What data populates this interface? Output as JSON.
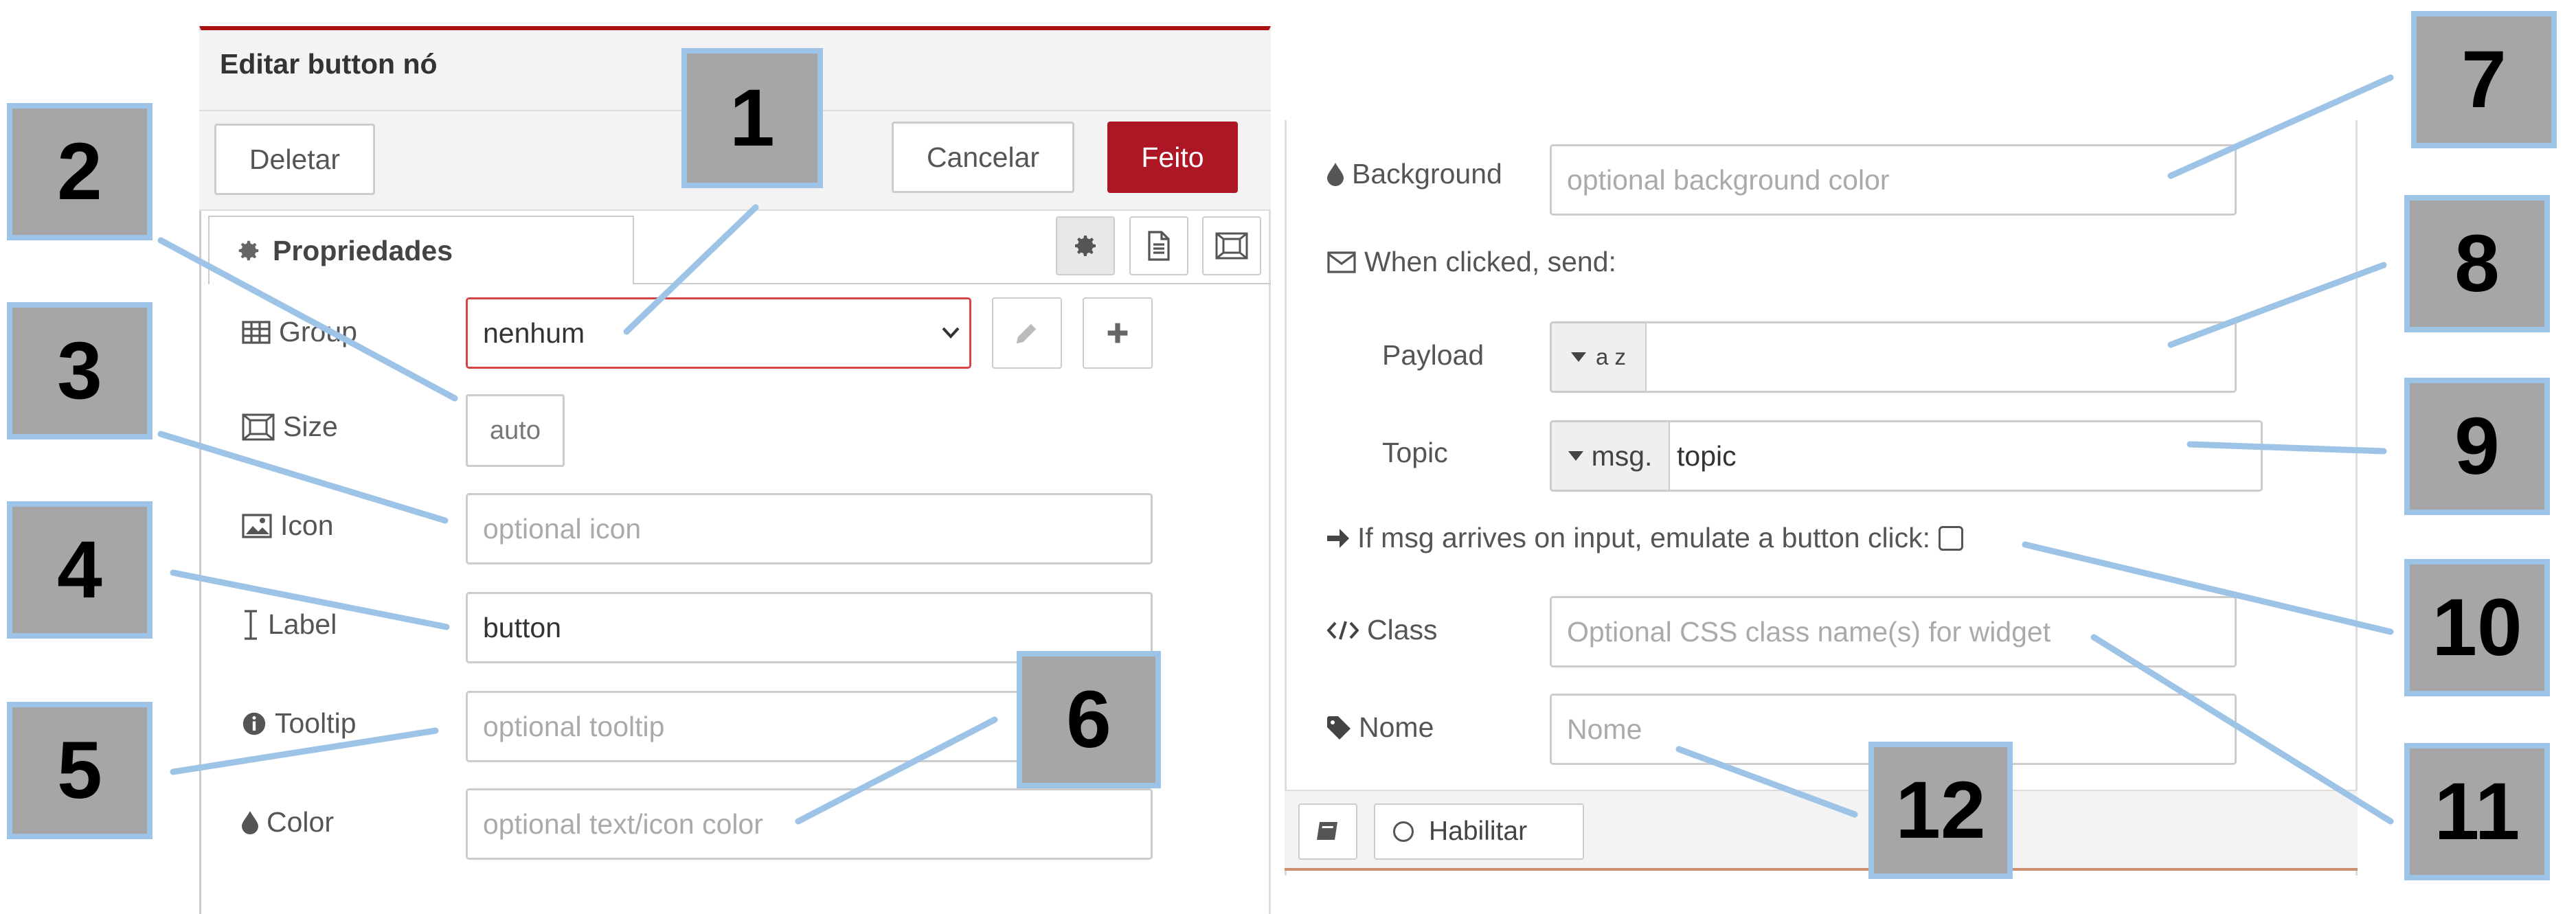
{
  "editor": {
    "title": "Editar button nó",
    "delete_label": "Deletar",
    "cancel_label": "Cancelar",
    "done_label": "Feito",
    "tab_label": "Propriedades",
    "fields": {
      "group_label": "Group",
      "group_value": "nenhum",
      "size_label": "Size",
      "size_value": "auto",
      "icon_label": "Icon",
      "icon_placeholder": "optional icon",
      "label_label": "Label",
      "label_value": "button",
      "tooltip_label": "Tooltip",
      "tooltip_placeholder": "optional tooltip",
      "color_label": "Color",
      "color_placeholder": "optional text/icon color",
      "background_label": "Background",
      "background_placeholder": "optional background color",
      "when_clicked_label": "When clicked, send:",
      "payload_label": "Payload",
      "payload_type": "a z",
      "topic_label": "Topic",
      "topic_type": "msg.",
      "topic_value": "topic",
      "emulate_label": "If msg arrives on input, emulate a button click:",
      "class_label": "Class",
      "class_placeholder": "Optional CSS class name(s) for widget",
      "name_label": "Nome",
      "name_placeholder": "Nome"
    },
    "footer": {
      "enable_label": "Habilitar"
    }
  },
  "callouts": [
    "1",
    "2",
    "3",
    "4",
    "5",
    "6",
    "7",
    "8",
    "9",
    "10",
    "11",
    "12"
  ],
  "colors": {
    "accent": "#ad1625",
    "badge_fill": "#a6a6a6",
    "badge_border": "#9dc3e6",
    "leader_line": "#9dc3e6"
  }
}
